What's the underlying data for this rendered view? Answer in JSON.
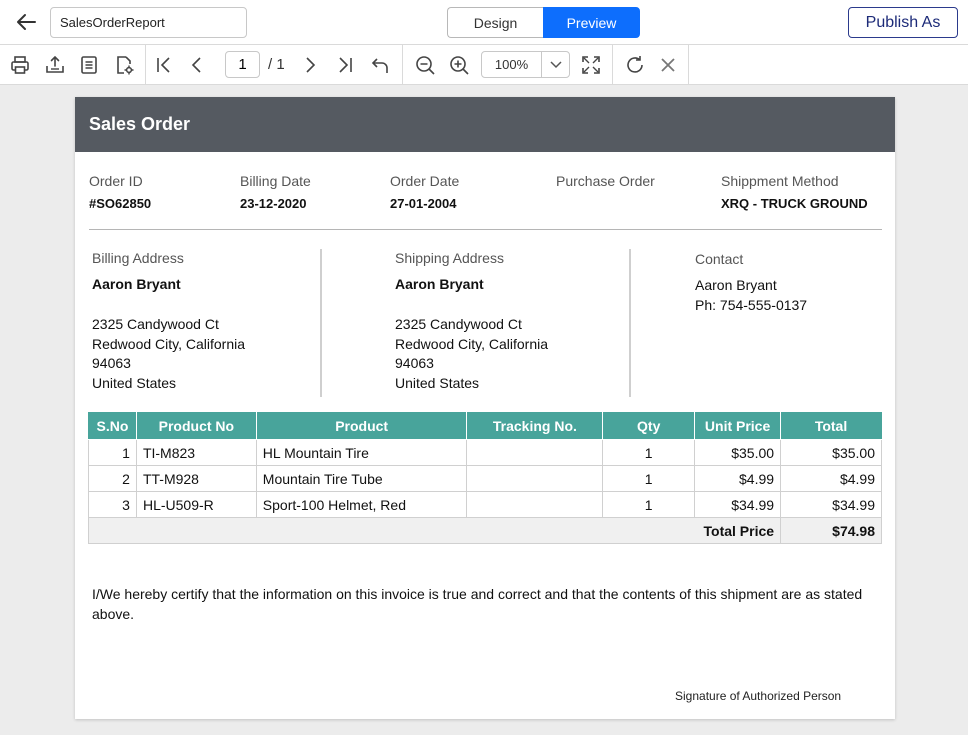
{
  "header": {
    "report_name": "SalesOrderReport",
    "design_label": "Design",
    "preview_label": "Preview",
    "publish_label": "Publish As",
    "accent_color": "#0d6efd"
  },
  "toolbar": {
    "icons": [
      "print-icon",
      "export-icon",
      "parameters-icon",
      "page-setup-icon",
      "first-page-icon",
      "previous-page-icon",
      "next-page-icon",
      "last-page-icon",
      "back-to-parent-icon",
      "zoom-out-icon",
      "zoom-in-icon",
      "fit-page-icon",
      "refresh-icon",
      "cancel-icon"
    ],
    "current_page": "1",
    "total_pages": "/ 1",
    "zoom": "100%"
  },
  "document": {
    "title": "Sales Order",
    "header_color": "#555a61",
    "order_id": {
      "label": "Order ID",
      "value": "#SO62850"
    },
    "billing_date": {
      "label": "Billing Date",
      "value": "23-12-2020"
    },
    "order_date": {
      "label": "Order Date",
      "value": "27-01-2004"
    },
    "purchase_order": {
      "label": "Purchase Order",
      "value": ""
    },
    "shipment_method": {
      "label": "Shippment Method",
      "value": "XRQ - TRUCK GROUND"
    },
    "billing_address": {
      "label": "Billing Address",
      "name": "Aaron Bryant",
      "lines": [
        "2325 Candywood Ct",
        "Redwood City, California",
        "94063",
        "United States"
      ]
    },
    "shipping_address": {
      "label": "Shipping Address",
      "name": "Aaron Bryant",
      "lines": [
        "2325 Candywood Ct",
        "Redwood City, California",
        "94063",
        "United States"
      ]
    },
    "contact": {
      "label": "Contact",
      "name": "Aaron Bryant",
      "phone": "Ph: 754-555-0137"
    },
    "table": {
      "header_color": "#48a49b",
      "columns": [
        "S.No",
        "Product No",
        "Product",
        "Tracking No.",
        "Qty",
        "Unit Price",
        "Total"
      ],
      "rows": [
        {
          "sno": "1",
          "product_no": "TI-M823",
          "product": "HL Mountain Tire",
          "tracking": "",
          "qty": "1",
          "unit_price": "$35.00",
          "total": "$35.00"
        },
        {
          "sno": "2",
          "product_no": "TT-M928",
          "product": "Mountain Tire Tube",
          "tracking": "",
          "qty": "1",
          "unit_price": "$4.99",
          "total": "$4.99"
        },
        {
          "sno": "3",
          "product_no": "HL-U509-R",
          "product": "Sport-100 Helmet, Red",
          "tracking": "",
          "qty": "1",
          "unit_price": "$34.99",
          "total": "$34.99"
        }
      ],
      "total_label": "Total Price",
      "total_value": "$74.98"
    },
    "certification": "I/We hereby certify that the information on this invoice is true and correct and that the contents of this shipment are as stated above.",
    "signature": "Signature of Authorized Person"
  }
}
